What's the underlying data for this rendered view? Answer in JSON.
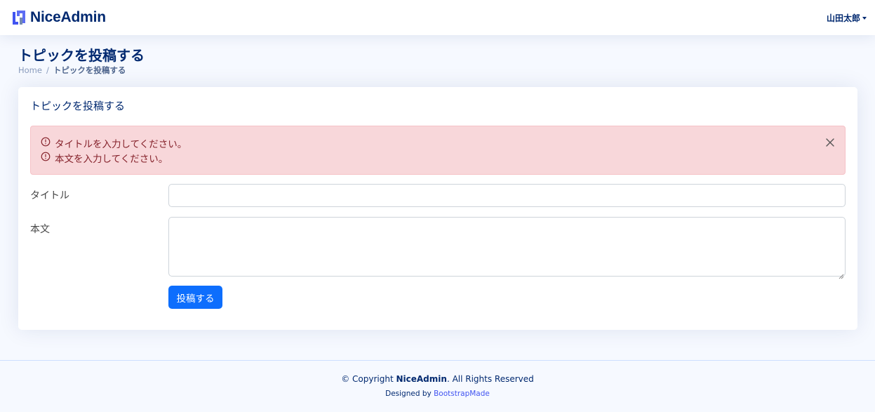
{
  "header": {
    "logo_text": "NiceAdmin",
    "user_name": "山田太郎"
  },
  "page": {
    "title": "トピックを投稿する",
    "breadcrumb": {
      "home": "Home",
      "separator": "/",
      "current": "トピックを投稿する"
    }
  },
  "card": {
    "title": "トピックを投稿する",
    "alert": {
      "messages": [
        "タイトルを入力してください。",
        "本文を入力してください。"
      ]
    },
    "form": {
      "title_label": "タイトル",
      "title_value": "",
      "body_label": "本文",
      "body_value": "",
      "submit_label": "投稿する"
    }
  },
  "footer": {
    "copyright_prefix": "© Copyright",
    "brand": "NiceAdmin",
    "rights": ". All Rights Reserved",
    "designed_by": "Designed by",
    "designer": "BootstrapMade"
  },
  "colors": {
    "brand_dark": "#012970",
    "primary": "#0d6efd",
    "alert_bg": "#f8d7da",
    "alert_text": "#842029",
    "page_bg": "#f6f9ff"
  }
}
